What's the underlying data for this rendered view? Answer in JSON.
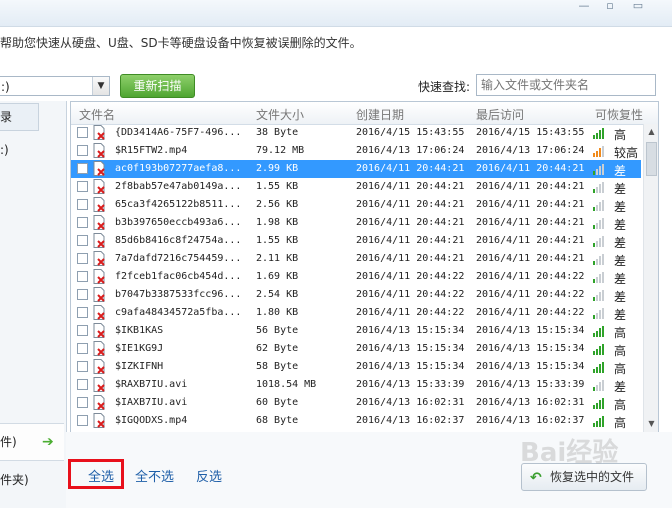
{
  "window": {
    "help_text": "帮助您快速从硬盘、U盘、SD卡等硬盘设备中恢复被误删除的文件。"
  },
  "toolbar": {
    "drive_value": ":)",
    "rescan_label": "重新扫描",
    "quick_search_label": "快速查找:",
    "search_placeholder": "输入文件或文件夹名"
  },
  "sidebar": {
    "header_label": "录",
    "item_top": ":)",
    "item_selected": "件)",
    "item_bottom": "件夹)"
  },
  "table": {
    "columns": [
      "文件名",
      "文件大小",
      "创建日期",
      "最后访问",
      "可恢复性"
    ],
    "rows": [
      {
        "name": "{DD3414A6-75F7-496...",
        "size": "38 Byte",
        "created": "2016/4/15 15:43:55",
        "accessed": "2016/4/15 15:43:55",
        "recover": "高",
        "level": "high",
        "selected": false
      },
      {
        "name": "$R15FTW2.mp4",
        "size": "79.12 MB",
        "created": "2016/4/13 17:06:24",
        "accessed": "2016/4/13 17:06:24",
        "recover": "较高",
        "level": "mid",
        "selected": false
      },
      {
        "name": "ac0f193b07277aefa8...",
        "size": "2.99 KB",
        "created": "2016/4/11 20:44:21",
        "accessed": "2016/4/11 20:44:21",
        "recover": "差",
        "level": "low",
        "selected": true
      },
      {
        "name": "2f8bab57e47ab0149a...",
        "size": "1.55 KB",
        "created": "2016/4/11 20:44:21",
        "accessed": "2016/4/11 20:44:21",
        "recover": "差",
        "level": "low",
        "selected": false
      },
      {
        "name": "65ca3f4265122b8511...",
        "size": "2.56 KB",
        "created": "2016/4/11 20:44:21",
        "accessed": "2016/4/11 20:44:21",
        "recover": "差",
        "level": "low",
        "selected": false
      },
      {
        "name": "b3b397650eccb493a6...",
        "size": "1.98 KB",
        "created": "2016/4/11 20:44:21",
        "accessed": "2016/4/11 20:44:21",
        "recover": "差",
        "level": "low",
        "selected": false
      },
      {
        "name": "85d6b8416c8f24754a...",
        "size": "1.55 KB",
        "created": "2016/4/11 20:44:21",
        "accessed": "2016/4/11 20:44:21",
        "recover": "差",
        "level": "low",
        "selected": false
      },
      {
        "name": "7a7dafd7216c754459...",
        "size": "2.11 KB",
        "created": "2016/4/11 20:44:21",
        "accessed": "2016/4/11 20:44:21",
        "recover": "差",
        "level": "low",
        "selected": false
      },
      {
        "name": "f2fceb1fac06cb454d...",
        "size": "1.69 KB",
        "created": "2016/4/11 20:44:22",
        "accessed": "2016/4/11 20:44:22",
        "recover": "差",
        "level": "low",
        "selected": false
      },
      {
        "name": "b7047b3387533fcc96...",
        "size": "2.54 KB",
        "created": "2016/4/11 20:44:22",
        "accessed": "2016/4/11 20:44:22",
        "recover": "差",
        "level": "low",
        "selected": false
      },
      {
        "name": "c9afa48434572a5fba...",
        "size": "1.80 KB",
        "created": "2016/4/11 20:44:22",
        "accessed": "2016/4/11 20:44:22",
        "recover": "差",
        "level": "low",
        "selected": false
      },
      {
        "name": "$IKB1KAS",
        "size": "56 Byte",
        "created": "2016/4/13 15:15:34",
        "accessed": "2016/4/13 15:15:34",
        "recover": "高",
        "level": "high",
        "selected": false
      },
      {
        "name": "$IE1KG9J",
        "size": "62 Byte",
        "created": "2016/4/13 15:15:34",
        "accessed": "2016/4/13 15:15:34",
        "recover": "高",
        "level": "high",
        "selected": false
      },
      {
        "name": "$IZKIFNH",
        "size": "58 Byte",
        "created": "2016/4/13 15:15:34",
        "accessed": "2016/4/13 15:15:34",
        "recover": "高",
        "level": "high",
        "selected": false
      },
      {
        "name": "$RAXB7IU.avi",
        "size": "1018.54 MB",
        "created": "2016/4/13 15:33:39",
        "accessed": "2016/4/13 15:33:39",
        "recover": "差",
        "level": "low",
        "selected": false
      },
      {
        "name": "$IAXB7IU.avi",
        "size": "60 Byte",
        "created": "2016/4/13 16:02:31",
        "accessed": "2016/4/13 16:02:31",
        "recover": "高",
        "level": "high",
        "selected": false
      },
      {
        "name": "$IGQODXS.mp4",
        "size": "68 Byte",
        "created": "2016/4/13 16:02:37",
        "accessed": "2016/4/13 16:02:37",
        "recover": "高",
        "level": "high",
        "selected": false
      }
    ]
  },
  "footer": {
    "select_all": "全选",
    "select_none": "全不选",
    "invert": "反选",
    "restore_label": "恢复选中的文件"
  },
  "watermark": "Bai经验",
  "colors": {
    "high": "#2fa32a",
    "mid": "#f08a1c",
    "low_active": "#2fa32a",
    "bar_off": "#c9ced3",
    "selection": "#3399ff",
    "highlight_box": "#e8101b"
  },
  "icons": {
    "file": "deleted-file-icon",
    "restore": "restore-arrow-icon",
    "rescan": "rescan-button"
  }
}
